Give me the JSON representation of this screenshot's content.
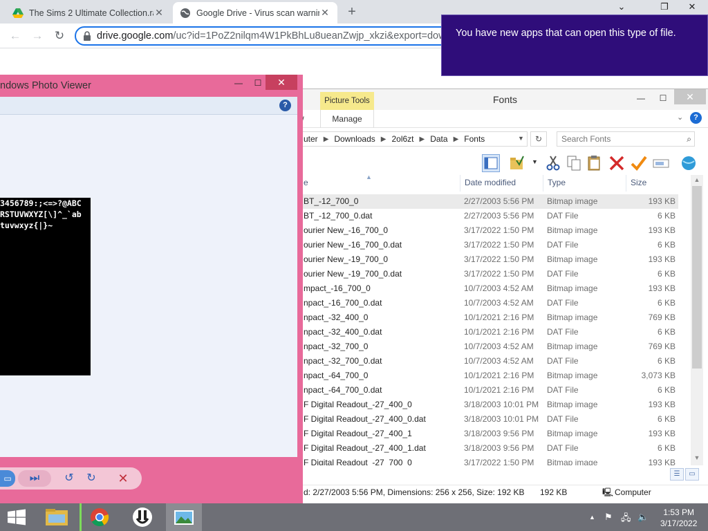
{
  "chrome": {
    "tabs": [
      {
        "title": "The Sims 2 Ultimate Collection.ra",
        "active": false
      },
      {
        "title": "Google Drive - Virus scan warnin",
        "active": true
      }
    ],
    "url_host": "drive.google.com",
    "url_rest": "/uc?id=1PoZ2nilqm4W1PkBhLu8ueanZwjp_xkzi&export=downl"
  },
  "notification": {
    "text": "You have new apps that can open this type of file."
  },
  "photo_viewer": {
    "title": "ndows Photo Viewer",
    "image_lines": [
      "3456789:;<=>?@ABC",
      "RSTUVWXYZ[\\]^_`ab",
      "tuvwxyz{|}~"
    ]
  },
  "explorer": {
    "context_tab": "Picture Tools",
    "ribbon_tab_partial": "w",
    "manage_tab": "Manage",
    "title": "Fonts",
    "breadcrumb": [
      "uter",
      "Downloads",
      "2ol6zt",
      "Data",
      "Fonts"
    ],
    "search_placeholder": "Search Fonts",
    "columns": {
      "name": "e",
      "date": "Date modified",
      "type": "Type",
      "size": "Size"
    },
    "files": [
      {
        "name": "BT_-12_700_0",
        "date": "2/27/2003 5:56 PM",
        "type": "Bitmap image",
        "size": "193 KB",
        "selected": true
      },
      {
        "name": "BT_-12_700_0.dat",
        "date": "2/27/2003 5:56 PM",
        "type": "DAT File",
        "size": "6 KB"
      },
      {
        "name": "ourier New_-16_700_0",
        "date": "3/17/2022 1:50 PM",
        "type": "Bitmap image",
        "size": "193 KB"
      },
      {
        "name": "ourier New_-16_700_0.dat",
        "date": "3/17/2022 1:50 PM",
        "type": "DAT File",
        "size": "6 KB"
      },
      {
        "name": "ourier New_-19_700_0",
        "date": "3/17/2022 1:50 PM",
        "type": "Bitmap image",
        "size": "193 KB"
      },
      {
        "name": "ourier New_-19_700_0.dat",
        "date": "3/17/2022 1:50 PM",
        "type": "DAT File",
        "size": "6 KB"
      },
      {
        "name": "mpact_-16_700_0",
        "date": "10/7/2003 4:52 AM",
        "type": "Bitmap image",
        "size": "193 KB"
      },
      {
        "name": "npact_-16_700_0.dat",
        "date": "10/7/2003 4:52 AM",
        "type": "DAT File",
        "size": "6 KB"
      },
      {
        "name": "npact_-32_400_0",
        "date": "10/1/2021 2:16 PM",
        "type": "Bitmap image",
        "size": "769 KB"
      },
      {
        "name": "npact_-32_400_0.dat",
        "date": "10/1/2021 2:16 PM",
        "type": "DAT File",
        "size": "6 KB"
      },
      {
        "name": "npact_-32_700_0",
        "date": "10/7/2003 4:52 AM",
        "type": "Bitmap image",
        "size": "769 KB"
      },
      {
        "name": "npact_-32_700_0.dat",
        "date": "10/7/2003 4:52 AM",
        "type": "DAT File",
        "size": "6 KB"
      },
      {
        "name": "npact_-64_700_0",
        "date": "10/1/2021 2:16 PM",
        "type": "Bitmap image",
        "size": "3,073 KB"
      },
      {
        "name": "npact_-64_700_0.dat",
        "date": "10/1/2021 2:16 PM",
        "type": "DAT File",
        "size": "6 KB"
      },
      {
        "name": "F Digital Readout_-27_400_0",
        "date": "3/18/2003 10:01 PM",
        "type": "Bitmap image",
        "size": "193 KB"
      },
      {
        "name": "F Digital Readout_-27_400_0.dat",
        "date": "3/18/2003 10:01 PM",
        "type": "DAT File",
        "size": "6 KB"
      },
      {
        "name": "F Digital Readout_-27_400_1",
        "date": "3/18/2003 9:56 PM",
        "type": "Bitmap image",
        "size": "193 KB"
      },
      {
        "name": "F Digital Readout_-27_400_1.dat",
        "date": "3/18/2003 9:56 PM",
        "type": "DAT File",
        "size": "6 KB"
      },
      {
        "name": "F Digital Readout_-27_700_0",
        "date": "3/17/2022 1:50 PM",
        "type": "Bitmap image",
        "size": "193 KB"
      }
    ],
    "status": {
      "details": "d: 2/27/2003 5:56 PM, Dimensions: 256 x 256, Size: 192 KB",
      "size": "192 KB",
      "location": "Computer"
    }
  },
  "taskbar": {
    "time": "1:53 PM",
    "date": "3/17/2022"
  },
  "colors": {
    "notification_bg": "#2f0d7a",
    "photo_viewer_frame": "#e86a9a",
    "taskbar": "#6e6f76",
    "omnibox_focus": "#1a73e8"
  }
}
